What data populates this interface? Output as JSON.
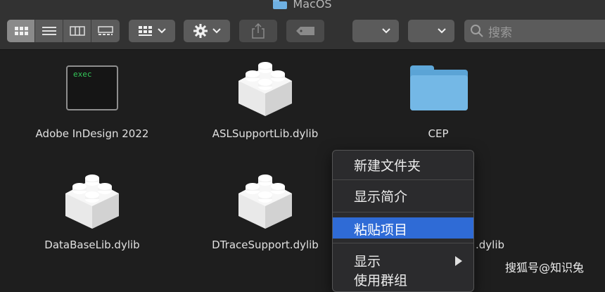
{
  "window": {
    "title": "MacOS",
    "folder_icon": "folder-icon"
  },
  "toolbar": {
    "view_modes": [
      {
        "name": "icon-view",
        "active": true
      },
      {
        "name": "list-view",
        "active": false
      },
      {
        "name": "column-view",
        "active": false
      },
      {
        "name": "gallery-view",
        "active": false
      }
    ],
    "group_icon": "grid-icon",
    "action_icon": "gear-icon",
    "share_icon": "share-icon",
    "tag_icon": "tag-icon",
    "search_placeholder": "搜索"
  },
  "files": [
    {
      "name": "Adobe InDesign 2022",
      "kind": "exec",
      "badge": "exec"
    },
    {
      "name": "ASLSupportLib.dylib",
      "kind": "dylib"
    },
    {
      "name": "CEP",
      "kind": "folder"
    },
    {
      "name": "DataBaseLib.dylib",
      "kind": "dylib"
    },
    {
      "name": "DTraceSupport.dylib",
      "kind": "dylib"
    },
    {
      "name": ".dylib",
      "kind": "dylib-partial"
    }
  ],
  "context_menu": {
    "items": [
      {
        "label": "新建文件夹"
      },
      {
        "label": "显示简介"
      },
      {
        "label": "粘贴项目",
        "highlighted": true
      },
      {
        "label": "显示",
        "submenu": true
      },
      {
        "label": "使用群组"
      }
    ]
  },
  "watermark": "搜狐号@知识兔",
  "colors": {
    "highlight": "#2f6bd6",
    "folder": "#74b8e6",
    "exec_text": "#34c759"
  }
}
